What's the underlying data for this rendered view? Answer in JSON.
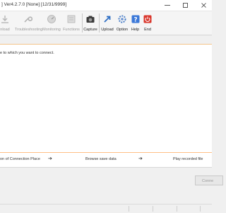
{
  "window": {
    "title": "] Ver4.2.7.0 [None] [12/31/9999]"
  },
  "toolbar": {
    "items": [
      {
        "label": "nload",
        "icon": "download-icon",
        "enabled": false
      },
      {
        "label": "Troubleshooting",
        "icon": "wrench-icon",
        "enabled": false
      },
      {
        "label": "Monitoring",
        "icon": "monitor-gauge-icon",
        "enabled": false
      },
      {
        "label": "Functions",
        "icon": "functions-icon",
        "enabled": false
      },
      {
        "label": "Capture",
        "icon": "camera-icon",
        "enabled": true
      },
      {
        "label": "Upload",
        "icon": "upload-icon",
        "enabled": true
      },
      {
        "label": "Option",
        "icon": "option-gear-icon",
        "enabled": true
      },
      {
        "label": "Help",
        "icon": "help-icon",
        "enabled": true
      },
      {
        "label": "End",
        "icon": "power-icon",
        "enabled": true
      }
    ]
  },
  "main": {
    "instruction": "e to which you want to connect."
  },
  "navigation": {
    "items": [
      {
        "label": "on of Connection Place"
      },
      {
        "label": "Browse save data"
      },
      {
        "label": "Play recorded file"
      }
    ],
    "arrow": "➔"
  },
  "footer": {
    "connect_label": "Conne"
  },
  "colors": {
    "accent_orange": "#f3c38a",
    "end_red": "#d9362b",
    "help_blue": "#3b78d8"
  }
}
